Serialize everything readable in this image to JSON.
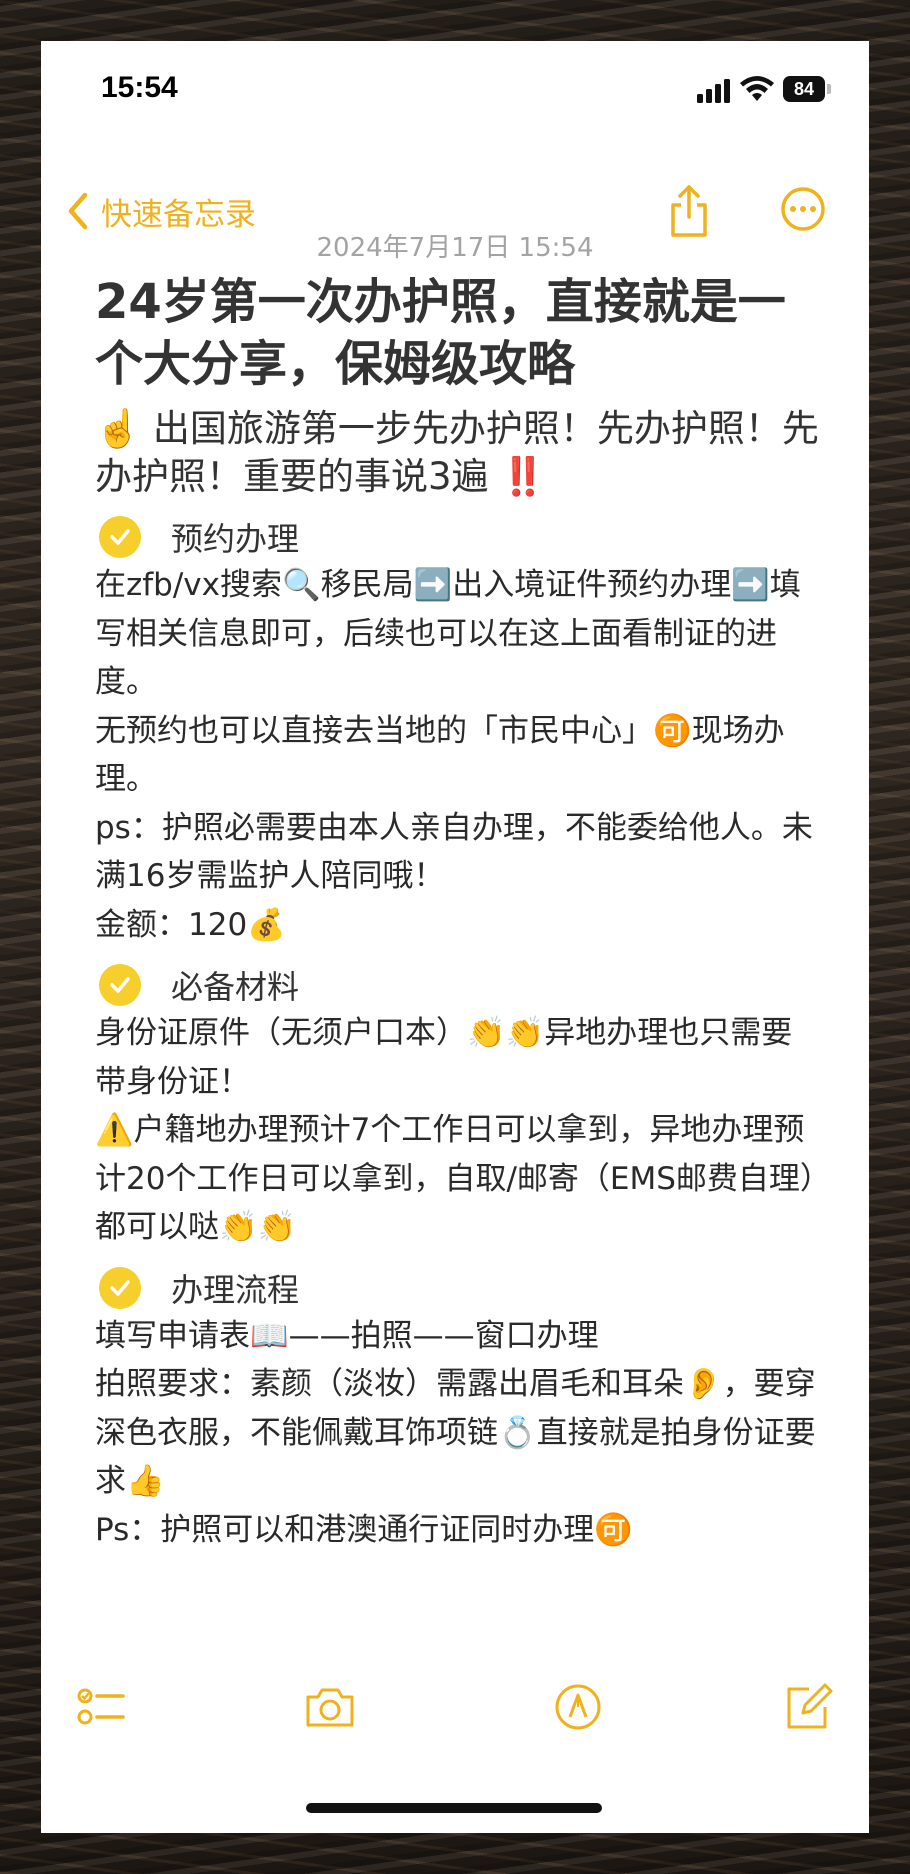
{
  "status_bar": {
    "time": "15:54",
    "battery": "84"
  },
  "nav": {
    "back_label": "快速备忘录"
  },
  "note": {
    "date": "2024年7月17日 15:54",
    "title": "24岁第一次办护照，直接就是一个大分享，保姆级攻略",
    "intro": "☝️ 出国旅游第一步先办护照！先办护照！先办护照！重要的事说3遍 ‼️",
    "sections": [
      {
        "heading": "预约办理",
        "lines": [
          "在zfb/vx搜索🔍移民局➡️出入境证件预约办理➡️填写相关信息即可，后续也可以在这上面看制证的进度。",
          "无预约也可以直接去当地的「市民中心」🉑现场办理。",
          "ps：护照必需要由本人亲自办理，不能委给他人。未满16岁需监护人陪同哦！",
          "金额：120💰"
        ]
      },
      {
        "heading": "必备材料",
        "lines": [
          "身份证原件（无须户口本）👏👏异地办理也只需要带身份证！",
          "⚠️户籍地办理预计7个工作日可以拿到，异地办理预计20个工作日可以拿到，自取/邮寄（EMS邮费自理）都可以哒👏👏"
        ]
      },
      {
        "heading": "办理流程",
        "lines": [
          "填写申请表📖——拍照——窗口办理",
          "拍照要求：素颜（淡妆）需露出眉毛和耳朵👂，要穿深色衣服，不能佩戴耳饰项链💍直接就是拍身份证要求👍",
          "Ps：护照可以和港澳通行证同时办理🉑"
        ]
      }
    ]
  },
  "colors": {
    "accent": "#f0b21c",
    "check": "#f7cf2c",
    "date": "#a3a3a3"
  },
  "icons": {
    "toolbar": [
      "checklist-icon",
      "camera-icon",
      "markup-pen-icon",
      "compose-icon"
    ],
    "nav": [
      "chevron-left-icon",
      "share-icon",
      "more-icon"
    ]
  }
}
